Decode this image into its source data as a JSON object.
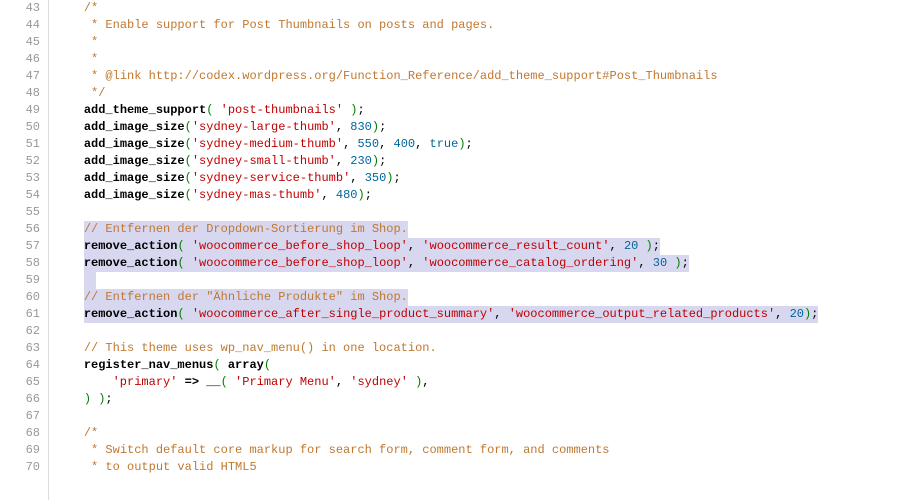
{
  "lines": [
    {
      "n": 43,
      "style": "plain",
      "tokens": [
        {
          "cls": "c-comment",
          "t": "/*"
        }
      ]
    },
    {
      "n": 44,
      "style": "plain",
      "tokens": [
        {
          "cls": "c-comment",
          "t": " * Enable support for Post Thumbnails on posts and pages."
        }
      ]
    },
    {
      "n": 45,
      "style": "plain",
      "tokens": [
        {
          "cls": "c-comment",
          "t": " *"
        }
      ]
    },
    {
      "n": 46,
      "style": "plain",
      "tokens": [
        {
          "cls": "c-comment",
          "t": " *"
        }
      ]
    },
    {
      "n": 47,
      "style": "plain",
      "tokens": [
        {
          "cls": "c-comment",
          "t": " * @link http://codex.wordpress.org/Function_Reference/add_theme_support#Post_Thumbnails"
        }
      ]
    },
    {
      "n": 48,
      "style": "plain",
      "tokens": [
        {
          "cls": "c-comment",
          "t": " */"
        }
      ]
    },
    {
      "n": 49,
      "style": "plain",
      "tokens": [
        {
          "cls": "c-func",
          "t": "add_theme_support"
        },
        {
          "cls": "c-paren",
          "t": "( "
        },
        {
          "cls": "c-str",
          "t": "'post-thumbnails'"
        },
        {
          "cls": "c-paren",
          "t": " )"
        },
        {
          "cls": "c-plain",
          "t": ";"
        }
      ]
    },
    {
      "n": 50,
      "style": "plain",
      "tokens": [
        {
          "cls": "c-func",
          "t": "add_image_size"
        },
        {
          "cls": "c-paren",
          "t": "("
        },
        {
          "cls": "c-str",
          "t": "'sydney-large-thumb'"
        },
        {
          "cls": "c-plain",
          "t": ", "
        },
        {
          "cls": "c-num",
          "t": "830"
        },
        {
          "cls": "c-paren",
          "t": ")"
        },
        {
          "cls": "c-plain",
          "t": ";"
        }
      ]
    },
    {
      "n": 51,
      "style": "plain",
      "tokens": [
        {
          "cls": "c-func",
          "t": "add_image_size"
        },
        {
          "cls": "c-paren",
          "t": "("
        },
        {
          "cls": "c-str",
          "t": "'sydney-medium-thumb'"
        },
        {
          "cls": "c-plain",
          "t": ", "
        },
        {
          "cls": "c-num",
          "t": "550"
        },
        {
          "cls": "c-plain",
          "t": ", "
        },
        {
          "cls": "c-num",
          "t": "400"
        },
        {
          "cls": "c-plain",
          "t": ", "
        },
        {
          "cls": "c-bool",
          "t": "true"
        },
        {
          "cls": "c-paren",
          "t": ")"
        },
        {
          "cls": "c-plain",
          "t": ";"
        }
      ]
    },
    {
      "n": 52,
      "style": "plain",
      "tokens": [
        {
          "cls": "c-func",
          "t": "add_image_size"
        },
        {
          "cls": "c-paren",
          "t": "("
        },
        {
          "cls": "c-str",
          "t": "'sydney-small-thumb'"
        },
        {
          "cls": "c-plain",
          "t": ", "
        },
        {
          "cls": "c-num",
          "t": "230"
        },
        {
          "cls": "c-paren",
          "t": ")"
        },
        {
          "cls": "c-plain",
          "t": ";"
        }
      ]
    },
    {
      "n": 53,
      "style": "plain",
      "tokens": [
        {
          "cls": "c-func",
          "t": "add_image_size"
        },
        {
          "cls": "c-paren",
          "t": "("
        },
        {
          "cls": "c-str",
          "t": "'sydney-service-thumb'"
        },
        {
          "cls": "c-plain",
          "t": ", "
        },
        {
          "cls": "c-num",
          "t": "350"
        },
        {
          "cls": "c-paren",
          "t": ")"
        },
        {
          "cls": "c-plain",
          "t": ";"
        }
      ]
    },
    {
      "n": 54,
      "style": "plain",
      "tokens": [
        {
          "cls": "c-func",
          "t": "add_image_size"
        },
        {
          "cls": "c-paren",
          "t": "("
        },
        {
          "cls": "c-str",
          "t": "'sydney-mas-thumb'"
        },
        {
          "cls": "c-plain",
          "t": ", "
        },
        {
          "cls": "c-num",
          "t": "480"
        },
        {
          "cls": "c-paren",
          "t": ")"
        },
        {
          "cls": "c-plain",
          "t": ";"
        }
      ]
    },
    {
      "n": 55,
      "style": "empty",
      "tokens": []
    },
    {
      "n": 56,
      "style": "hl",
      "tokens": [
        {
          "cls": "c-comment",
          "t": "// Entfernen der Dropdown-Sortierung im Shop."
        }
      ]
    },
    {
      "n": 57,
      "style": "hl",
      "tokens": [
        {
          "cls": "c-func",
          "t": "remove_action"
        },
        {
          "cls": "c-paren",
          "t": "( "
        },
        {
          "cls": "c-str",
          "t": "'woocommerce_before_shop_loop'"
        },
        {
          "cls": "c-plain",
          "t": ", "
        },
        {
          "cls": "c-str",
          "t": "'woocommerce_result_count'"
        },
        {
          "cls": "c-plain",
          "t": ", "
        },
        {
          "cls": "c-num",
          "t": "20"
        },
        {
          "cls": "c-paren",
          "t": " )"
        },
        {
          "cls": "c-plain",
          "t": ";"
        }
      ]
    },
    {
      "n": 58,
      "style": "hl",
      "tokens": [
        {
          "cls": "c-func",
          "t": "remove_action"
        },
        {
          "cls": "c-paren",
          "t": "( "
        },
        {
          "cls": "c-str",
          "t": "'woocommerce_before_shop_loop'"
        },
        {
          "cls": "c-plain",
          "t": ", "
        },
        {
          "cls": "c-str",
          "t": "'woocommerce_catalog_ordering'"
        },
        {
          "cls": "c-plain",
          "t": ", "
        },
        {
          "cls": "c-num",
          "t": "30"
        },
        {
          "cls": "c-paren",
          "t": " )"
        },
        {
          "cls": "c-plain",
          "t": ";"
        }
      ]
    },
    {
      "n": 59,
      "style": "hl-lead",
      "tokens": []
    },
    {
      "n": 60,
      "style": "hl",
      "tokens": [
        {
          "cls": "c-comment",
          "t": "// Entfernen der \"Ähnliche Produkte\" im Shop."
        }
      ]
    },
    {
      "n": 61,
      "style": "hl",
      "tokens": [
        {
          "cls": "c-func",
          "t": "remove_action"
        },
        {
          "cls": "c-paren",
          "t": "( "
        },
        {
          "cls": "c-str",
          "t": "'woocommerce_after_single_product_summary'"
        },
        {
          "cls": "c-plain",
          "t": ", "
        },
        {
          "cls": "c-str",
          "t": "'woocommerce_output_related_products'"
        },
        {
          "cls": "c-plain",
          "t": ", "
        },
        {
          "cls": "c-num",
          "t": "20"
        },
        {
          "cls": "c-paren",
          "t": ")"
        },
        {
          "cls": "c-plain",
          "t": ";"
        }
      ]
    },
    {
      "n": 62,
      "style": "empty",
      "tokens": []
    },
    {
      "n": 63,
      "style": "plain",
      "tokens": [
        {
          "cls": "c-comment",
          "t": "// This theme uses wp_nav_menu() in one location."
        }
      ]
    },
    {
      "n": 64,
      "style": "plain",
      "tokens": [
        {
          "cls": "c-func",
          "t": "register_nav_menus"
        },
        {
          "cls": "c-paren",
          "t": "( "
        },
        {
          "cls": "c-func",
          "t": "array"
        },
        {
          "cls": "c-paren",
          "t": "("
        }
      ]
    },
    {
      "n": 65,
      "style": "indent2",
      "tokens": [
        {
          "cls": "c-str",
          "t": "'primary'"
        },
        {
          "cls": "c-plain",
          "t": " "
        },
        {
          "cls": "c-op",
          "t": "=>"
        },
        {
          "cls": "c-plain",
          "t": " "
        },
        {
          "cls": "c-func",
          "t": "__"
        },
        {
          "cls": "c-paren",
          "t": "( "
        },
        {
          "cls": "c-str",
          "t": "'Primary Menu'"
        },
        {
          "cls": "c-plain",
          "t": ", "
        },
        {
          "cls": "c-str",
          "t": "'sydney'"
        },
        {
          "cls": "c-paren",
          "t": " )"
        },
        {
          "cls": "c-plain",
          "t": ","
        }
      ]
    },
    {
      "n": 66,
      "style": "plain",
      "tokens": [
        {
          "cls": "c-paren",
          "t": ") )"
        },
        {
          "cls": "c-plain",
          "t": ";"
        }
      ]
    },
    {
      "n": 67,
      "style": "empty",
      "tokens": []
    },
    {
      "n": 68,
      "style": "plain",
      "tokens": [
        {
          "cls": "c-comment",
          "t": "/*"
        }
      ]
    },
    {
      "n": 69,
      "style": "plain",
      "tokens": [
        {
          "cls": "c-comment",
          "t": " * Switch default core markup for search form, comment form, and comments"
        }
      ]
    },
    {
      "n": 70,
      "style": "plain",
      "tokens": [
        {
          "cls": "c-comment",
          "t": " * to output valid HTML5"
        }
      ]
    }
  ],
  "indent": "    ",
  "indent2": "        "
}
